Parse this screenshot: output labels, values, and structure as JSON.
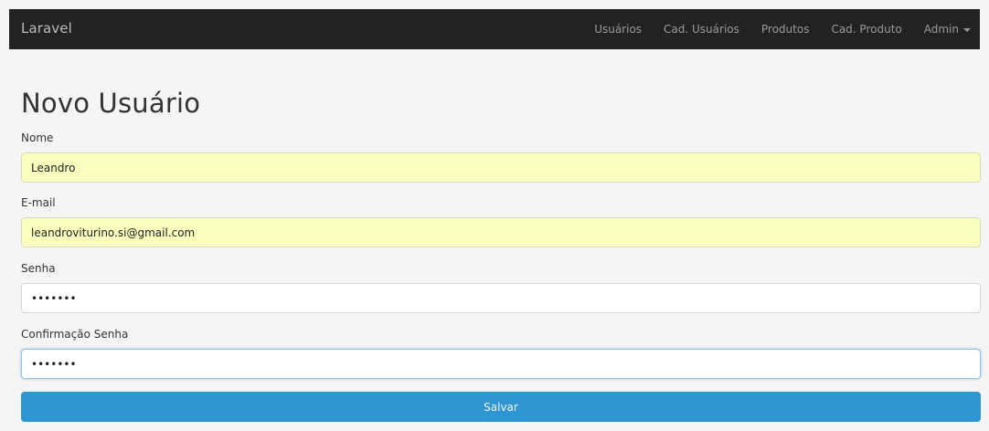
{
  "navbar": {
    "brand": "Laravel",
    "links": [
      "Usuários",
      "Cad. Usuários",
      "Produtos",
      "Cad. Produto"
    ],
    "admin_label": "Admin"
  },
  "page": {
    "title": "Novo Usuário"
  },
  "form": {
    "nome": {
      "label": "Nome",
      "value": "Leandro"
    },
    "email": {
      "label": "E-mail",
      "value": "leandroviturino.si@gmail.com"
    },
    "senha": {
      "label": "Senha",
      "value": "•••••••"
    },
    "confirmacao": {
      "label": "Confirmação Senha",
      "value": "•••••••"
    },
    "submit_label": "Salvar"
  },
  "colors": {
    "navbar": "#222222",
    "autofill": "#faffbd",
    "primary_button": "#2f96d4"
  }
}
